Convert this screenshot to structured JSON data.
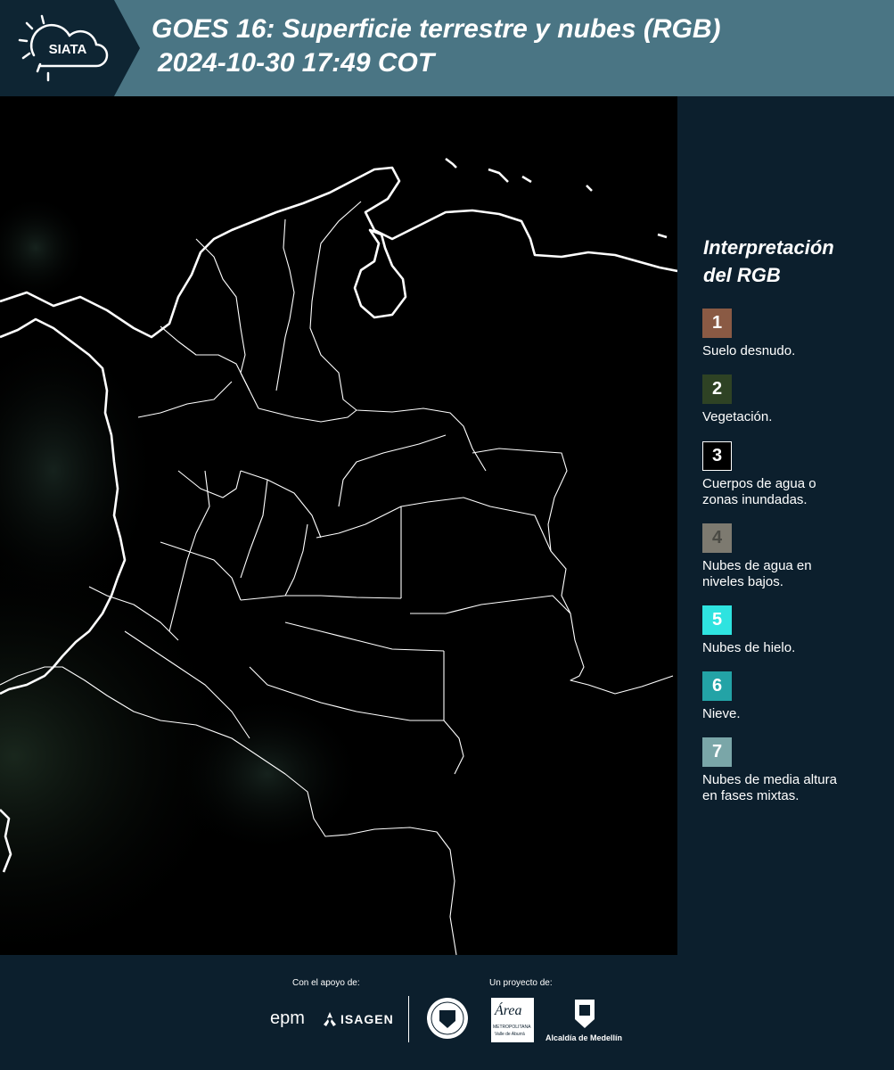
{
  "header": {
    "logo_text": "SIATA",
    "title_line1": "GOES 16: Superficie terrestre y nubes (RGB)",
    "title_line2": "2024-10-30 17:49 COT",
    "background_color": "#4a7584"
  },
  "map": {
    "background_color": "#000000",
    "border_color": "#ffffff"
  },
  "legend": {
    "title_line1": "Interpretación",
    "title_line2": "del RGB",
    "items": [
      {
        "number": "1",
        "label_lines": [
          "Suelo desnudo."
        ],
        "color": "#8a5a44",
        "number_color": "#ffffff"
      },
      {
        "number": "2",
        "label_lines": [
          "Vegetación."
        ],
        "color": "#2e4224",
        "number_color": "#ffffff"
      },
      {
        "number": "3",
        "label_lines": [
          "Cuerpos de agua o",
          "zonas inundadas."
        ],
        "color": "#000000",
        "number_color": "#ffffff"
      },
      {
        "number": "4",
        "label_lines": [
          "Nubes de agua en",
          "niveles bajos."
        ],
        "color": "#7d7a70",
        "number_color": "#4a4a44"
      },
      {
        "number": "5",
        "label_lines": [
          "Nubes de hielo."
        ],
        "color": "#2ee3e0",
        "number_color": "#ffffff"
      },
      {
        "number": "6",
        "label_lines": [
          "Nieve."
        ],
        "color": "#23a3a6",
        "number_color": "#ffffff"
      },
      {
        "number": "7",
        "label_lines": [
          "Nubes de media altura",
          "en fases mixtas."
        ],
        "color": "#7aa6a8",
        "number_color": "#ffffff"
      }
    ]
  },
  "footer": {
    "support_caption": "Con el apoyo de:",
    "project_caption": "Un proyecto de:",
    "sponsor_epm": "epm",
    "sponsor_isagen": "ISAGEN",
    "partner_area": "Área",
    "partner_area_sub": "METROPOLITANA",
    "partner_area_sub2": "Valle de Aburrá",
    "partner_alcaldia": "Alcaldía de Medellín"
  }
}
